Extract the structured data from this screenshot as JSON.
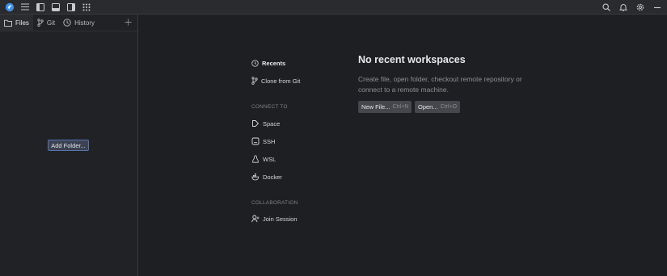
{
  "titlebar": {
    "icons_left": [
      "app-logo-icon",
      "hamburger-menu-icon",
      "left-panel-icon",
      "bottom-panel-icon",
      "right-panel-icon",
      "grid-apps-icon"
    ],
    "icons_right": [
      "search-icon",
      "bell-icon",
      "gear-icon",
      "minimize-icon"
    ]
  },
  "sidebar": {
    "tabs": [
      {
        "label": "Files",
        "icon": "folder-icon"
      },
      {
        "label": "Git",
        "icon": "git-branch-icon"
      },
      {
        "label": "History",
        "icon": "clock-icon"
      }
    ],
    "add_folder_label": "Add Folder..."
  },
  "nav": {
    "recents": "Recents",
    "clone": "Clone from Git",
    "connect_to_label": "CONNECT TO",
    "connect_items": [
      "Space",
      "SSH",
      "WSL",
      "Docker"
    ],
    "collaboration_label": "COLLABORATION",
    "join_session": "Join Session"
  },
  "welcome": {
    "title": "No recent workspaces",
    "text": "Create file, open folder, checkout remote repository or connect to a remote machine.",
    "new_file_label": "New File...",
    "new_file_shortcut": "Ctrl+N",
    "open_label": "Open...",
    "open_shortcut": "Ctrl+O"
  },
  "colors": {
    "background": "#1e1f22",
    "sidebar": "#212226",
    "accent": "#5874b0",
    "logo": "#3d8ee6"
  }
}
